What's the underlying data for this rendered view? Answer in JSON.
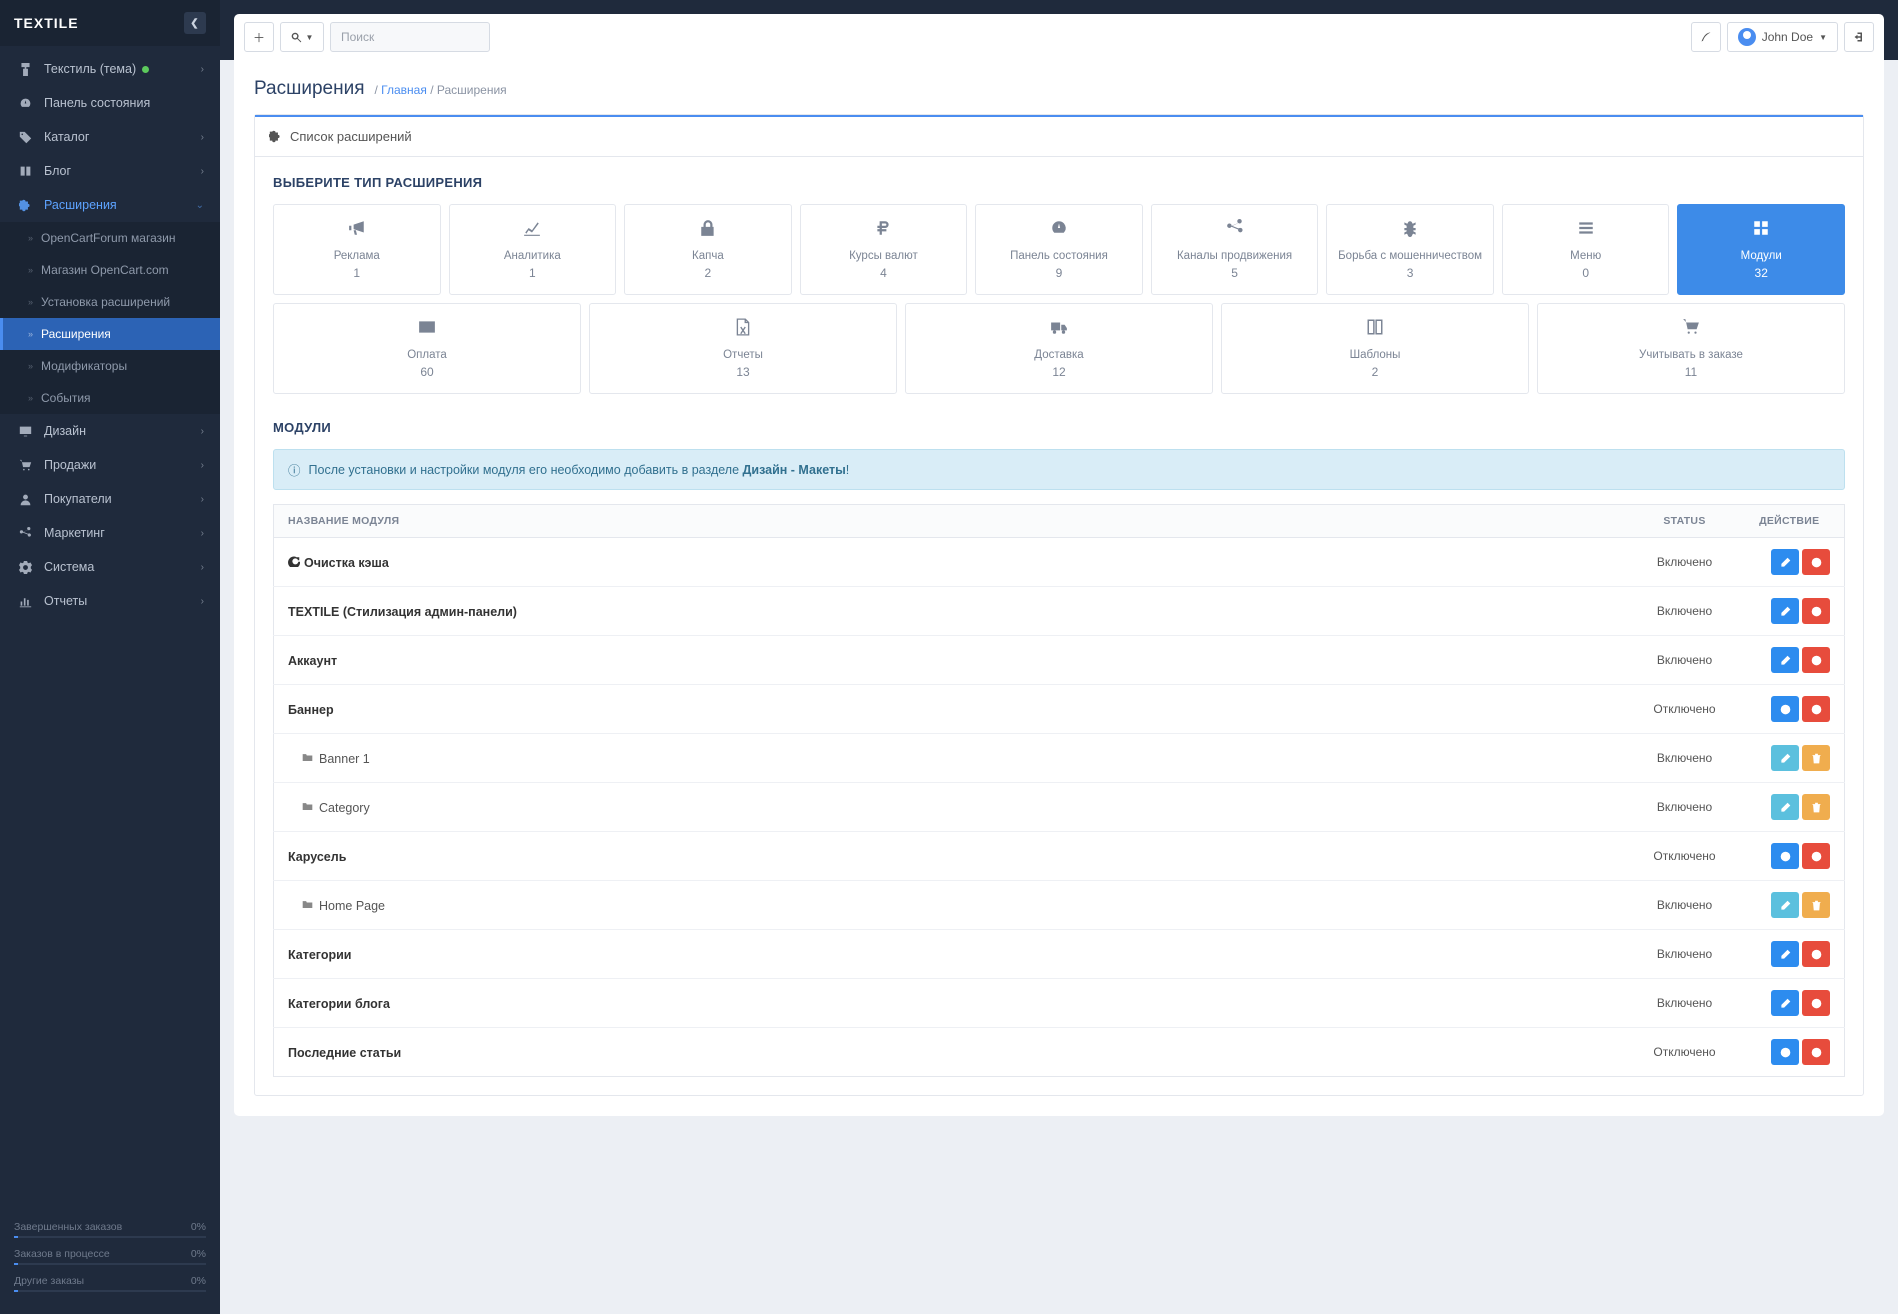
{
  "brand": "TEXTILE",
  "search": {
    "placeholder": "Поиск"
  },
  "user": {
    "name": "John Doe"
  },
  "sidebar": {
    "items": [
      {
        "label": "Текстиль (тема)",
        "icon": "paint",
        "dot": true,
        "expandable": true
      },
      {
        "label": "Панель состояния",
        "icon": "dashboard",
        "expandable": false
      },
      {
        "label": "Каталог",
        "icon": "tags",
        "expandable": true
      },
      {
        "label": "Блог",
        "icon": "book",
        "expandable": true
      },
      {
        "label": "Расширения",
        "icon": "puzzle",
        "expandable": true,
        "active": true,
        "children": [
          {
            "label": "OpenCartForum магазин"
          },
          {
            "label": "Магазин OpenCart.com"
          },
          {
            "label": "Установка расширений"
          },
          {
            "label": "Расширения",
            "active": true
          },
          {
            "label": "Модификаторы"
          },
          {
            "label": "События"
          }
        ]
      },
      {
        "label": "Дизайн",
        "icon": "desktop",
        "expandable": true
      },
      {
        "label": "Продажи",
        "icon": "cart",
        "expandable": true
      },
      {
        "label": "Покупатели",
        "icon": "user",
        "expandable": true
      },
      {
        "label": "Маркетинг",
        "icon": "share",
        "expandable": true
      },
      {
        "label": "Система",
        "icon": "gear",
        "expandable": true
      },
      {
        "label": "Отчеты",
        "icon": "bar",
        "expandable": true
      }
    ],
    "stats": [
      {
        "label": "Завершенных заказов",
        "value": "0%"
      },
      {
        "label": "Заказов в процессе",
        "value": "0%"
      },
      {
        "label": "Другие заказы",
        "value": "0%"
      }
    ]
  },
  "page": {
    "title": "Расширения",
    "breadcrumb_home": "Главная",
    "breadcrumb_current": "Расширения",
    "panel_title": "Список расширений",
    "choose_title": "ВЫБЕРИТЕ ТИП РАСШИРЕНИЯ",
    "modules_title": "МОДУЛИ",
    "alert_pre": "После установки и настройки модуля его необходимо добавить в разделе ",
    "alert_bold": "Дизайн - Макеты",
    "table": {
      "th_name": "НАЗВАНИЕ МОДУЛЯ",
      "th_status": "STATUS",
      "th_action": "ДЕЙСТВИЕ"
    }
  },
  "ext_types_row1": [
    {
      "label": "Реклама",
      "count": "1",
      "icon": "megaphone"
    },
    {
      "label": "Аналитика",
      "count": "1",
      "icon": "lineChart"
    },
    {
      "label": "Капча",
      "count": "2",
      "icon": "lock"
    },
    {
      "label": "Курсы валют",
      "count": "4",
      "icon": "ruble"
    },
    {
      "label": "Панель состояния",
      "count": "9",
      "icon": "dashboard"
    },
    {
      "label": "Каналы продвижения",
      "count": "5",
      "icon": "share"
    },
    {
      "label": "Борьба с мошенничеством",
      "count": "3",
      "icon": "bug"
    },
    {
      "label": "Меню",
      "count": "0",
      "icon": "menu"
    },
    {
      "label": "Модули",
      "count": "32",
      "icon": "grid",
      "active": true
    }
  ],
  "ext_types_row2": [
    {
      "label": "Оплата",
      "count": "60",
      "icon": "card"
    },
    {
      "label": "Отчеты",
      "count": "13",
      "icon": "excel"
    },
    {
      "label": "Доставка",
      "count": "12",
      "icon": "truck"
    },
    {
      "label": "Шаблоны",
      "count": "2",
      "icon": "columns"
    },
    {
      "label": "Учитывать в заказе",
      "count": "11",
      "icon": "cart"
    }
  ],
  "modules": [
    {
      "name": "Очистка кэша",
      "prefix_icon": true,
      "status": "Включено",
      "actions": [
        "edit",
        "remove"
      ]
    },
    {
      "name": "TEXTILE (Стилизация админ-панели)",
      "status": "Включено",
      "actions": [
        "edit",
        "remove"
      ]
    },
    {
      "name": "Аккаунт",
      "status": "Включено",
      "actions": [
        "edit",
        "remove"
      ]
    },
    {
      "name": "Баннер",
      "status": "Отключено",
      "actions": [
        "install",
        "remove"
      ]
    },
    {
      "name": "Banner 1",
      "child": true,
      "status": "Включено",
      "actions": [
        "edit-light",
        "delete"
      ]
    },
    {
      "name": "Category",
      "child": true,
      "status": "Включено",
      "actions": [
        "edit-light",
        "delete"
      ]
    },
    {
      "name": "Карусель",
      "status": "Отключено",
      "actions": [
        "install",
        "remove"
      ]
    },
    {
      "name": "Home Page",
      "child": true,
      "status": "Включено",
      "actions": [
        "edit-light",
        "delete"
      ]
    },
    {
      "name": "Категории",
      "status": "Включено",
      "actions": [
        "edit",
        "remove"
      ]
    },
    {
      "name": "Категории блога",
      "status": "Включено",
      "actions": [
        "edit",
        "remove"
      ]
    },
    {
      "name": "Последние статьи",
      "status": "Отключено",
      "actions": [
        "install",
        "remove"
      ]
    }
  ]
}
